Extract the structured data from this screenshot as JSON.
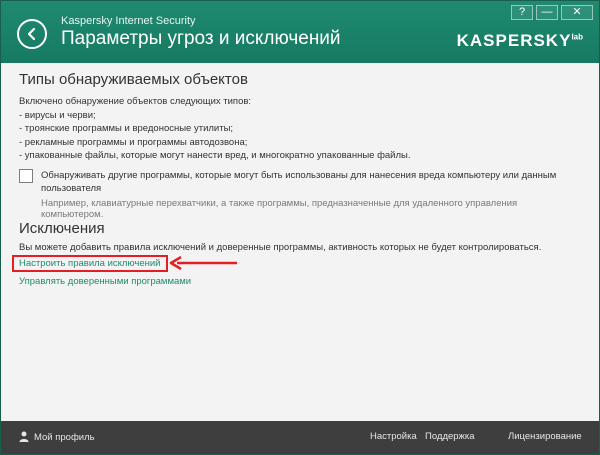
{
  "window": {
    "app_name": "Kaspersky Internet Security",
    "page_title": "Параметры угроз и исключений",
    "logo_text": "KASPERSKY",
    "logo_suffix": "lab",
    "controls": {
      "help": "?",
      "minimize": "—",
      "close": "✕"
    }
  },
  "detected_objects": {
    "title": "Типы обнаруживаемых объектов",
    "intro": "Включено обнаружение объектов следующих типов:",
    "items": [
      "- вирусы и черви;",
      "- троянские программы и вредоносные утилиты;",
      "- рекламные программы и программы автодозвона;",
      "- упакованные файлы, которые могут нанести вред, и многократно упакованные файлы."
    ],
    "checkbox_label": "Обнаруживать другие программы, которые могут быть использованы для нанесения вреда компьютеру или данным пользователя",
    "checkbox_checked": false,
    "checkbox_hint": "Например, клавиатурные перехватчики, а также программы, предназначенные для удаленного управления компьютером."
  },
  "exclusions": {
    "title": "Исключения",
    "text": "Вы можете добавить правила исключений и доверенные программы, активность которых не будет контролироваться.",
    "link_rules": "Настроить правила исключений",
    "link_trusted": "Управлять доверенными программами"
  },
  "footer": {
    "profile": "Мой профиль",
    "settings": "Настройка",
    "support": "Поддержка",
    "licensing": "Лицензирование"
  },
  "colors": {
    "accent": "#1f8a70",
    "footer_bg": "#3e3e3e",
    "highlight": "#e31e24"
  }
}
